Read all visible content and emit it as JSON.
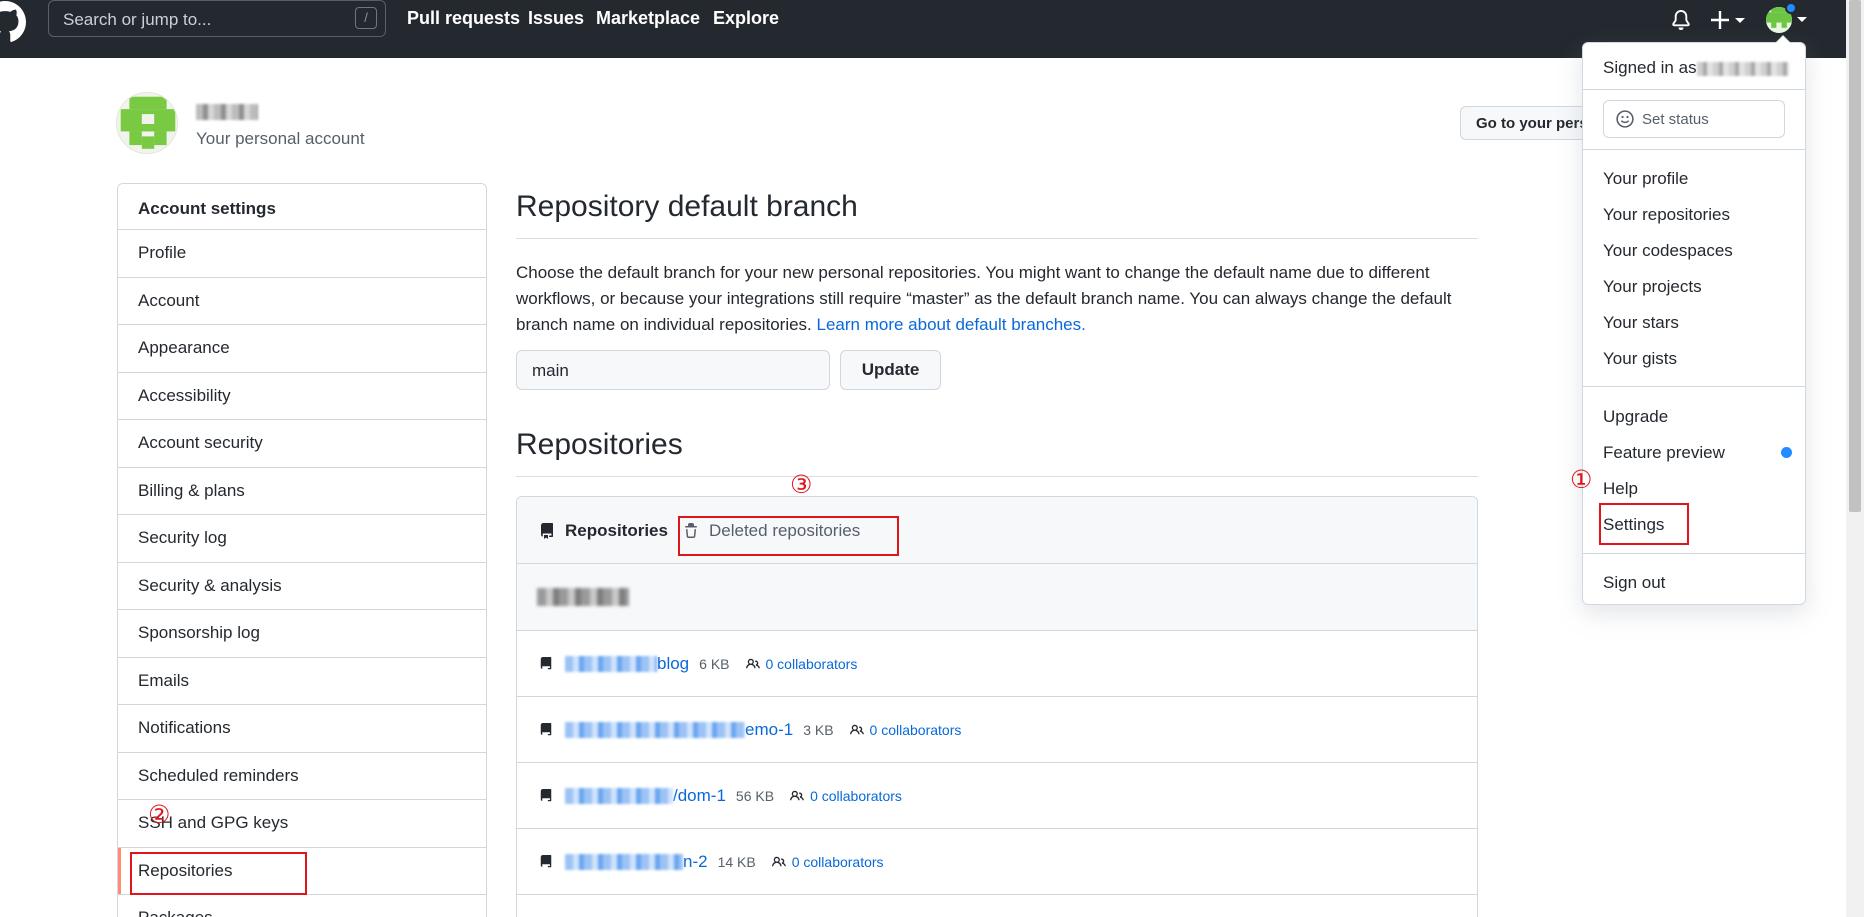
{
  "header": {
    "search_placeholder": "Search or jump to...",
    "search_shortcut": "/",
    "nav": [
      "Pull requests",
      "Issues",
      "Marketplace",
      "Explore"
    ],
    "icons": [
      "github-logo",
      "bell-icon",
      "plus-icon",
      "avatar"
    ]
  },
  "account": {
    "subtitle": "Your personal account",
    "go_to_profile": "Go to your personal profile"
  },
  "sidebar": {
    "heading": "Account settings",
    "items": [
      {
        "label": "Profile"
      },
      {
        "label": "Account"
      },
      {
        "label": "Appearance"
      },
      {
        "label": "Accessibility"
      },
      {
        "label": "Account security"
      },
      {
        "label": "Billing & plans"
      },
      {
        "label": "Security log"
      },
      {
        "label": "Security & analysis"
      },
      {
        "label": "Sponsorship log"
      },
      {
        "label": "Emails"
      },
      {
        "label": "Notifications"
      },
      {
        "label": "Scheduled reminders"
      },
      {
        "label": "SSH and GPG keys"
      },
      {
        "label": "Repositories"
      },
      {
        "label": "Packages"
      }
    ],
    "active_index": 13
  },
  "main": {
    "branch_title": "Repository default branch",
    "branch_desc": "Choose the default branch for your new personal repositories. You might want to change the default name due to different workflows, or because your integrations still require “master” as the default branch name. You can always change the default branch name on individual repositories. ",
    "branch_link": "Learn more about default branches.",
    "branch_value": "main",
    "update_label": "Update",
    "repos_title": "Repositories",
    "tab_repositories": "Repositories",
    "tab_deleted": "Deleted repositories",
    "repos": [
      {
        "suffix": "blog",
        "size": "6 KB",
        "collaborators": "0 collaborators"
      },
      {
        "suffix": "emo-1",
        "size": "3 KB",
        "collaborators": "0 collaborators"
      },
      {
        "suffix": "/dom-1",
        "size": "56 KB",
        "collaborators": "0 collaborators"
      },
      {
        "suffix": "n-2",
        "size": "14 KB",
        "collaborators": "0 collaborators"
      }
    ]
  },
  "dropdown": {
    "signed_in_as": "Signed in as",
    "set_status": "Set status",
    "group1": [
      "Your profile",
      "Your repositories",
      "Your codespaces",
      "Your projects",
      "Your stars",
      "Your gists"
    ],
    "group2": [
      "Upgrade",
      "Feature preview",
      "Help",
      "Settings"
    ],
    "sign_out": "Sign out"
  },
  "annotations": {
    "step1": "①",
    "step2": "②",
    "step3": "③",
    "color": "#e0151b"
  },
  "colors": {
    "header_bg": "#24292f",
    "link": "#0969da",
    "border": "#d0d7de"
  }
}
